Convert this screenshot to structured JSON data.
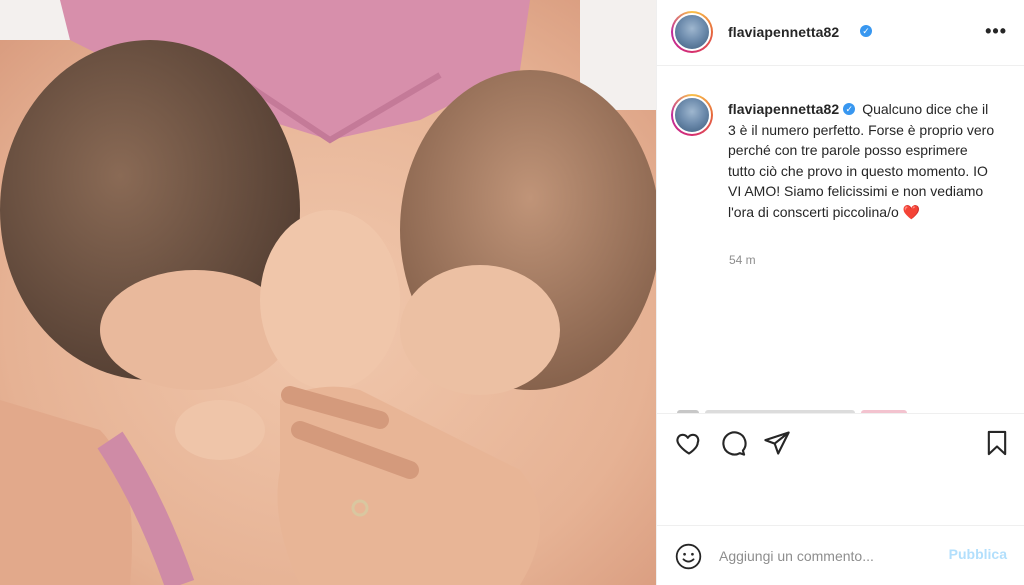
{
  "post": {
    "username": "flaviapennetta82",
    "verified_glyph": "✓",
    "caption": "Qualcuno dice che il 3 è il numero perfetto. Forse è proprio vero perché con tre parole posso esprimere tutto ciò che provo in questo momento. IO VI AMO! Siamo felicissimi e non vediamo l'ora di conscerti piccolina/o",
    "caption_emoji": "❤️",
    "timestamp": "54 m"
  },
  "header": {
    "more_label": "•••"
  },
  "comment_box": {
    "placeholder": "Aggiungi un commento...",
    "post_label": "Pubblica"
  },
  "icons": {
    "like": "heart-icon",
    "comment": "comment-icon",
    "share": "paper-plane-icon",
    "save": "bookmark-icon",
    "emoji": "smiley-icon"
  },
  "colors": {
    "verified": "#3897f0",
    "post_button_disabled": "#b2dffc",
    "heart": "#e0245e",
    "border": "#efefef",
    "muted_text": "#8e8e8e"
  }
}
